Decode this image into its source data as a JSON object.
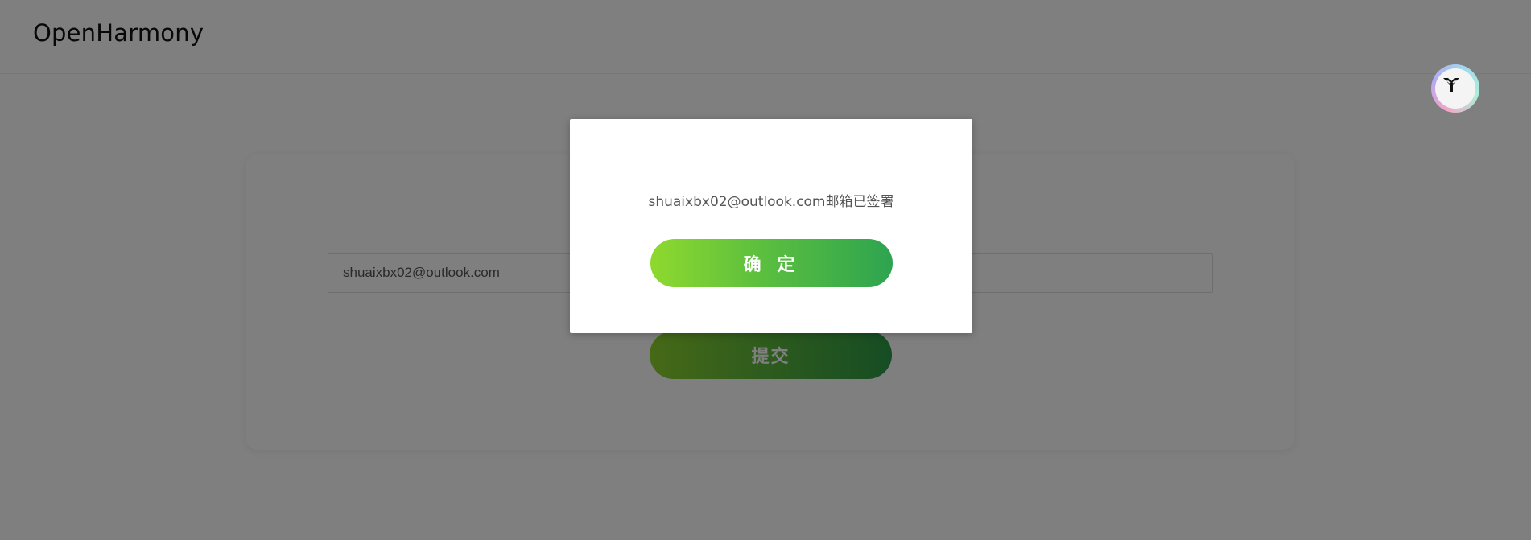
{
  "header": {
    "brand": "OpenHarmony"
  },
  "form": {
    "email_value": "shuaixbx02@outlook.com",
    "submit_label": "提交"
  },
  "dialog": {
    "message": "shuaixbx02@outlook.com邮箱已签署",
    "confirm_label": "确 定"
  },
  "assistant": {
    "icon": "assistant-logo-icon"
  },
  "colors": {
    "accent_start": "#8dd32e",
    "accent_end": "#2d9a48",
    "overlay": "rgba(0,0,0,0.5)"
  }
}
